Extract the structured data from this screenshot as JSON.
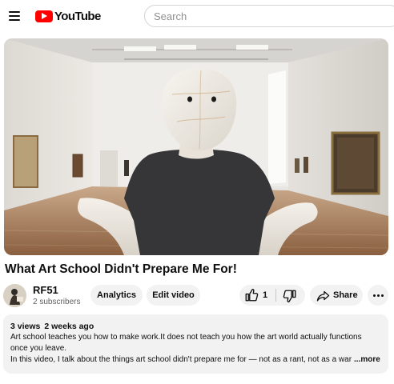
{
  "header": {
    "logo_text": "YouTube",
    "search_placeholder": "Search",
    "icons": {
      "menu": "hamburger-menu-icon",
      "logo": "youtube-play-logo-icon"
    }
  },
  "video": {
    "title": "What Art School Didn't Prepare Me For!",
    "thumbnail_description": "person with white mannequin head shrugging in front of a museum gallery"
  },
  "channel": {
    "name": "RF51",
    "subscribers": "2 subscribers"
  },
  "actions": {
    "analytics_label": "Analytics",
    "edit_label": "Edit video",
    "like_count": "1",
    "share_label": "Share",
    "icons": {
      "like": "thumbs-up-icon",
      "dislike": "thumbs-down-icon",
      "share": "share-arrow-icon",
      "more": "more-horizontal-icon"
    }
  },
  "description": {
    "views": "3 views",
    "age": "2 weeks ago",
    "line1": "Art school teaches you how to make work.It does not teach you how the art world actually functions",
    "line2": "once you leave.",
    "line3": "In this video, I talk about the things art school didn't prepare me for — not as a rant, not as a war",
    "more_label": "...more"
  },
  "colors": {
    "brand_red": "#ff0000",
    "chip_background": "#f2f2f2",
    "text_primary": "#0f0f0f",
    "text_secondary": "#606060"
  }
}
